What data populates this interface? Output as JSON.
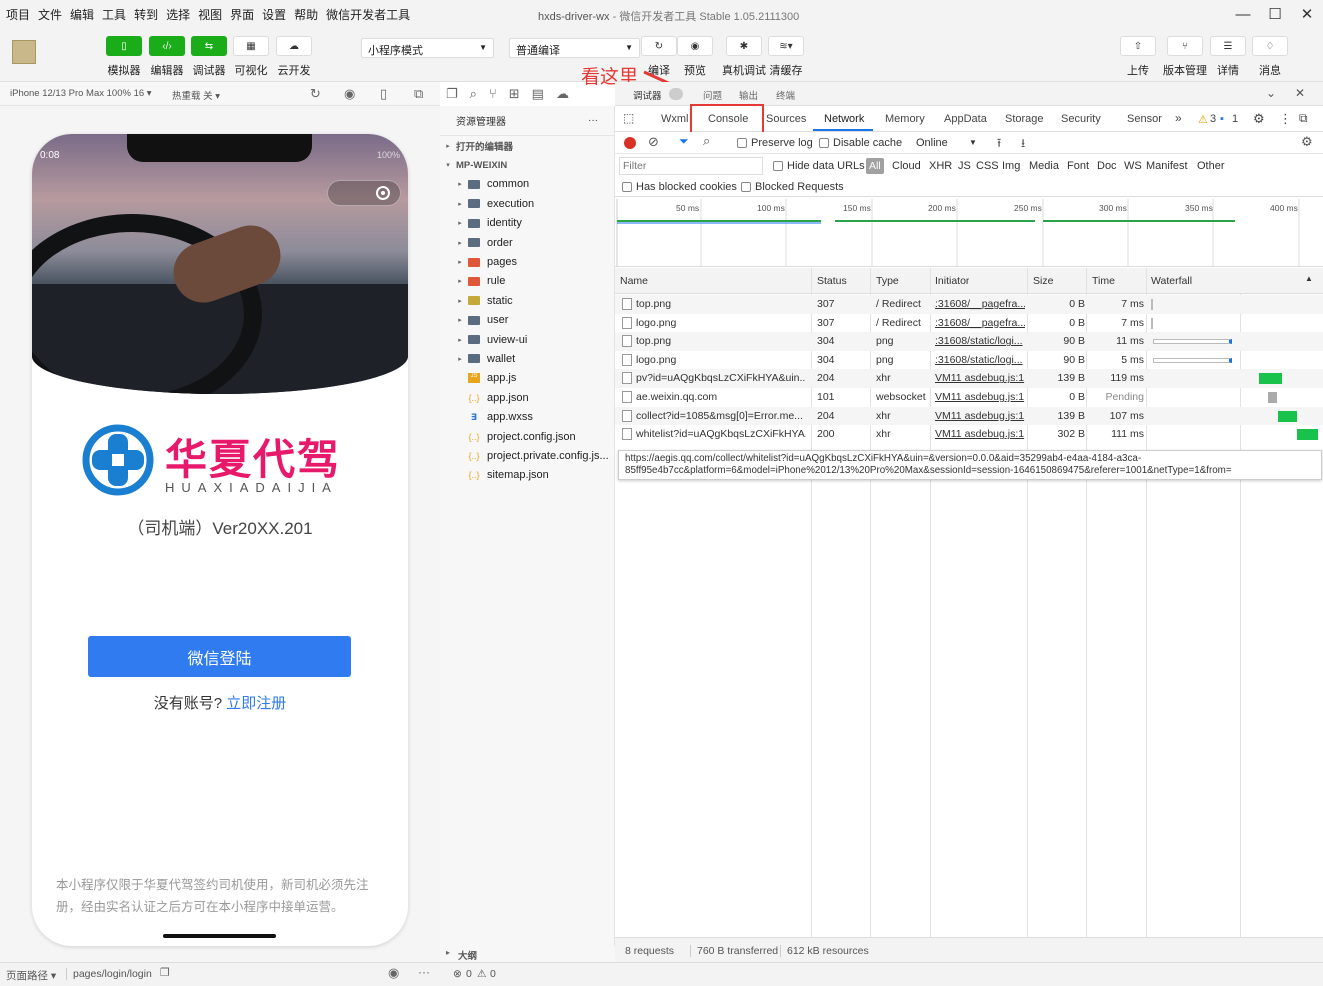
{
  "menubar": {
    "items": [
      "项目",
      "文件",
      "编辑",
      "工具",
      "转到",
      "选择",
      "视图",
      "界面",
      "设置",
      "帮助",
      "微信开发者工具"
    ],
    "title": "hxds-driver-wx",
    "subtitle": "微信开发者工具 Stable 1.05.2111300"
  },
  "toolbar": {
    "left_buttons": [
      "模拟器",
      "编辑器",
      "调试器",
      "可视化",
      "云开发"
    ],
    "mode_select": "小程序模式",
    "compile_select": "普通编译",
    "mid_buttons": [
      "编译",
      "预览",
      "真机调试",
      "清缓存"
    ],
    "right_buttons": [
      "上传",
      "版本管理",
      "详情",
      "消息"
    ],
    "annotation": "看这里"
  },
  "simbar": {
    "device": "iPhone 12/13 Pro Max 100% 16 ▾",
    "hotreload": "热重载 关 ▾"
  },
  "phone": {
    "time": "0:08",
    "battery": "100%",
    "brand": "华夏代驾",
    "brand_sub": "HUAXIADAIJIA",
    "version": "（司机端）Ver20XX.201",
    "login_button": "微信登陆",
    "register_prefix": "没有账号?",
    "register_link": "立即注册",
    "notice": "本小程序仅限于华夏代驾签约司机使用，新司机必须先注册，经由实名认证之后方可在本小程序中接单运营。"
  },
  "filepanel": {
    "header": "资源管理器",
    "more": "···",
    "open_editors": "打开的编辑器",
    "project": "MP-WEIXIN",
    "folders": [
      "common",
      "execution",
      "identity",
      "order",
      "pages",
      "rule",
      "static",
      "user",
      "uview-ui",
      "wallet"
    ],
    "files": [
      "app.js",
      "app.json",
      "app.wxss",
      "project.config.json",
      "project.private.config.js...",
      "sitemap.json"
    ],
    "outline": "大纲"
  },
  "devtools": {
    "top_tabs": [
      "调试器",
      "问题",
      "输出",
      "终端"
    ],
    "tabs": [
      "Wxml",
      "Console",
      "Sources",
      "Network",
      "Memory",
      "AppData",
      "Storage",
      "Security",
      "Sensor"
    ],
    "active_tab": "Network",
    "warn_count": "3",
    "info_count": "1",
    "preserve_log": "Preserve log",
    "disable_cache": "Disable cache",
    "online": "Online",
    "filter_placeholder": "Filter",
    "hide_data_urls": "Hide data URLs",
    "types": [
      "All",
      "Cloud",
      "XHR",
      "JS",
      "CSS",
      "Img",
      "Media",
      "Font",
      "Doc",
      "WS",
      "Manifest",
      "Other"
    ],
    "has_blocked": "Has blocked cookies",
    "blocked_requests": "Blocked Requests",
    "timeline_ticks": [
      "50 ms",
      "100 ms",
      "150 ms",
      "200 ms",
      "250 ms",
      "300 ms",
      "350 ms",
      "400 ms"
    ],
    "columns": [
      "Name",
      "Status",
      "Type",
      "Initiator",
      "Size",
      "Time",
      "Waterfall"
    ],
    "rows": [
      {
        "name": "top.png",
        "status": "307",
        "type": "/ Redirect",
        "initiator": ":31608/__pagefra...",
        "size": "0 B",
        "time": "7 ms"
      },
      {
        "name": "logo.png",
        "status": "307",
        "type": "/ Redirect",
        "initiator": ":31608/__pagefra...",
        "size": "0 B",
        "time": "7 ms"
      },
      {
        "name": "top.png",
        "status": "304",
        "type": "png",
        "initiator": ":31608/static/logi...",
        "size": "90 B",
        "time": "11 ms"
      },
      {
        "name": "logo.png",
        "status": "304",
        "type": "png",
        "initiator": ":31608/static/logi...",
        "size": "90 B",
        "time": "5 ms"
      },
      {
        "name": "pv?id=uAQgKbqsLzCXiFkHYA&uin...",
        "status": "204",
        "type": "xhr",
        "initiator": "VM11 asdebug.js:1",
        "size": "139 B",
        "time": "119 ms"
      },
      {
        "name": "ae.weixin.qq.com",
        "status": "101",
        "type": "websocket",
        "initiator": "VM11 asdebug.js:1",
        "size": "0 B",
        "time": "Pending"
      },
      {
        "name": "collect?id=1085&msg[0]=Error.me...",
        "status": "204",
        "type": "xhr",
        "initiator": "VM11 asdebug.js:1",
        "size": "139 B",
        "time": "107 ms"
      },
      {
        "name": "whitelist?id=uAQgKbqsLzCXiFkHYA...",
        "status": "200",
        "type": "xhr",
        "initiator": "VM11 asdebug.js:1",
        "size": "302 B",
        "time": "111 ms"
      }
    ],
    "tooltip_line1": "https://aegis.qq.com/collect/whitelist?id=uAQgKbqsLzCXiFkHYA&uin=&version=0.0.0&aid=35299ab4-e4aa-4184-a3ca-",
    "tooltip_line2": "85ff95e4b7cc&platform=6&model=iPhone%2012/13%20Pro%20Max&sessionId=session-1646150869475&referer=1001&netType=1&from=",
    "status_requests": "8 requests",
    "status_transferred": "760 B transferred",
    "status_resources": "612 kB resources"
  },
  "bottombar": {
    "path_label": "页面路径 ▾",
    "path": "pages/login/login",
    "errors": "0",
    "warnings": "0"
  },
  "colors": {
    "accent": "#1aad19",
    "link": "#2f7bef",
    "brand": "#e8186b",
    "annotation": "#e53935"
  }
}
